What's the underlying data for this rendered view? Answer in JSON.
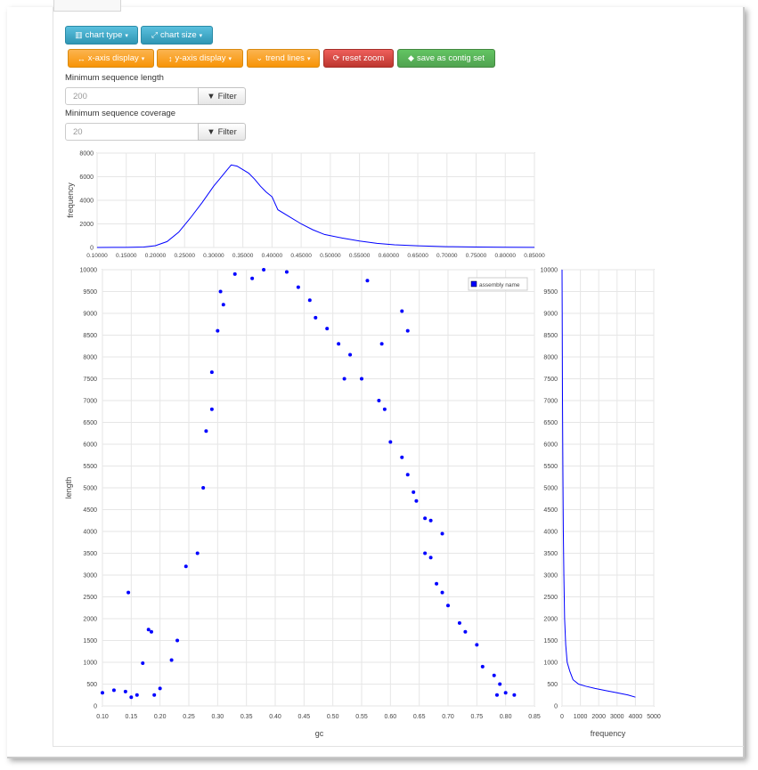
{
  "toolbar": {
    "chart_type": "chart type",
    "chart_size": "chart size",
    "x_axis_display": "x-axis display",
    "y_axis_display": "y-axis display",
    "trend_lines": "trend lines",
    "reset_zoom": "reset zoom",
    "save_as_contig_set": "save as contig set"
  },
  "filters": {
    "min_length_label": "Minimum sequence length",
    "min_length_placeholder": "200",
    "min_coverage_label": "Minimum sequence coverage",
    "min_coverage_placeholder": "20",
    "filter_button": "Filter"
  },
  "colors": {
    "series": "#0000ff",
    "grid": "#e6e6e6"
  },
  "chart_data": [
    {
      "type": "line",
      "ylabel": "frequency",
      "xlim": [
        0.1,
        0.85
      ],
      "ylim": [
        0,
        8000
      ],
      "x_ticks": [
        "0.10000",
        "0.15000",
        "0.20000",
        "0.25000",
        "0.30000",
        "0.35000",
        "0.40000",
        "0.45000",
        "0.50000",
        "0.55000",
        "0.60000",
        "0.65000",
        "0.70000",
        "0.75000",
        "0.80000",
        "0.85000"
      ],
      "y_ticks": [
        0,
        2000,
        4000,
        6000,
        8000
      ],
      "x": [
        0.1,
        0.15,
        0.18,
        0.2,
        0.22,
        0.24,
        0.26,
        0.28,
        0.3,
        0.31,
        0.32,
        0.33,
        0.34,
        0.35,
        0.36,
        0.37,
        0.38,
        0.39,
        0.4,
        0.41,
        0.43,
        0.45,
        0.47,
        0.49,
        0.52,
        0.55,
        0.58,
        0.61,
        0.65,
        0.7,
        0.75,
        0.8,
        0.85
      ],
      "y": [
        0,
        10,
        40,
        150,
        500,
        1300,
        2500,
        3800,
        5200,
        5800,
        6400,
        7000,
        6900,
        6600,
        6300,
        5800,
        5200,
        4700,
        4300,
        3200,
        2600,
        2000,
        1500,
        1100,
        800,
        550,
        350,
        230,
        140,
        70,
        40,
        20,
        10
      ]
    },
    {
      "type": "scatter",
      "xlabel": "gc",
      "ylabel": "length",
      "legend": "assembly name",
      "legend_position": "top-right",
      "xlim": [
        0.1,
        0.85
      ],
      "ylim": [
        0,
        10000
      ],
      "x_ticks": [
        "0.10",
        "0.15",
        "0.20",
        "0.25",
        "0.30",
        "0.35",
        "0.40",
        "0.45",
        "0.50",
        "0.55",
        "0.60",
        "0.65",
        "0.70",
        "0.75",
        "0.80",
        "0.85"
      ],
      "y_ticks": [
        0,
        500,
        1000,
        1500,
        2000,
        2500,
        3000,
        3500,
        4000,
        4500,
        5000,
        5500,
        6000,
        6500,
        7000,
        7500,
        8000,
        8500,
        9000,
        9500,
        10000
      ],
      "points": [
        [
          0.1,
          300
        ],
        [
          0.12,
          360
        ],
        [
          0.14,
          330
        ],
        [
          0.145,
          2600
        ],
        [
          0.15,
          200
        ],
        [
          0.16,
          250
        ],
        [
          0.17,
          980
        ],
        [
          0.18,
          1750
        ],
        [
          0.185,
          1700
        ],
        [
          0.19,
          250
        ],
        [
          0.2,
          400
        ],
        [
          0.22,
          1050
        ],
        [
          0.23,
          1500
        ],
        [
          0.245,
          3200
        ],
        [
          0.265,
          3500
        ],
        [
          0.275,
          5000
        ],
        [
          0.28,
          6300
        ],
        [
          0.29,
          7650
        ],
        [
          0.29,
          6800
        ],
        [
          0.3,
          8600
        ],
        [
          0.305,
          9500
        ],
        [
          0.31,
          9200
        ],
        [
          0.33,
          9900
        ],
        [
          0.36,
          9800
        ],
        [
          0.38,
          10000
        ],
        [
          0.42,
          9950
        ],
        [
          0.44,
          9600
        ],
        [
          0.46,
          9300
        ],
        [
          0.47,
          8900
        ],
        [
          0.49,
          8650
        ],
        [
          0.51,
          8300
        ],
        [
          0.53,
          8050
        ],
        [
          0.56,
          9750
        ],
        [
          0.585,
          8300
        ],
        [
          0.62,
          9050
        ],
        [
          0.63,
          8600
        ],
        [
          0.52,
          7500
        ],
        [
          0.55,
          7500
        ],
        [
          0.58,
          7000
        ],
        [
          0.59,
          6800
        ],
        [
          0.6,
          6050
        ],
        [
          0.62,
          5700
        ],
        [
          0.63,
          5300
        ],
        [
          0.64,
          4900
        ],
        [
          0.645,
          4700
        ],
        [
          0.66,
          4300
        ],
        [
          0.67,
          4250
        ],
        [
          0.69,
          3950
        ],
        [
          0.66,
          3500
        ],
        [
          0.67,
          3400
        ],
        [
          0.68,
          2800
        ],
        [
          0.69,
          2600
        ],
        [
          0.7,
          2300
        ],
        [
          0.72,
          1900
        ],
        [
          0.73,
          1700
        ],
        [
          0.75,
          1400
        ],
        [
          0.76,
          900
        ],
        [
          0.78,
          700
        ],
        [
          0.79,
          500
        ],
        [
          0.8,
          300
        ],
        [
          0.815,
          250
        ],
        [
          0.785,
          250
        ]
      ]
    },
    {
      "type": "line",
      "xlabel": "frequency",
      "xlim": [
        0,
        5000
      ],
      "ylim": [
        0,
        10000
      ],
      "x_ticks": [
        0,
        1000,
        2000,
        3000,
        4000,
        5000
      ],
      "y_ticks": [
        0,
        500,
        1000,
        1500,
        2000,
        2500,
        3000,
        3500,
        4000,
        4500,
        5000,
        5500,
        6000,
        6500,
        7000,
        7500,
        8000,
        8500,
        9000,
        9500,
        10000
      ],
      "x": [
        4000,
        3600,
        3000,
        2400,
        1800,
        1300,
        900,
        600,
        420,
        280,
        200,
        140,
        100,
        70,
        45,
        25,
        10,
        0
      ],
      "y": [
        200,
        250,
        300,
        350,
        400,
        450,
        500,
        600,
        800,
        1000,
        1400,
        2000,
        3000,
        4000,
        5500,
        7000,
        9000,
        10000
      ]
    }
  ]
}
